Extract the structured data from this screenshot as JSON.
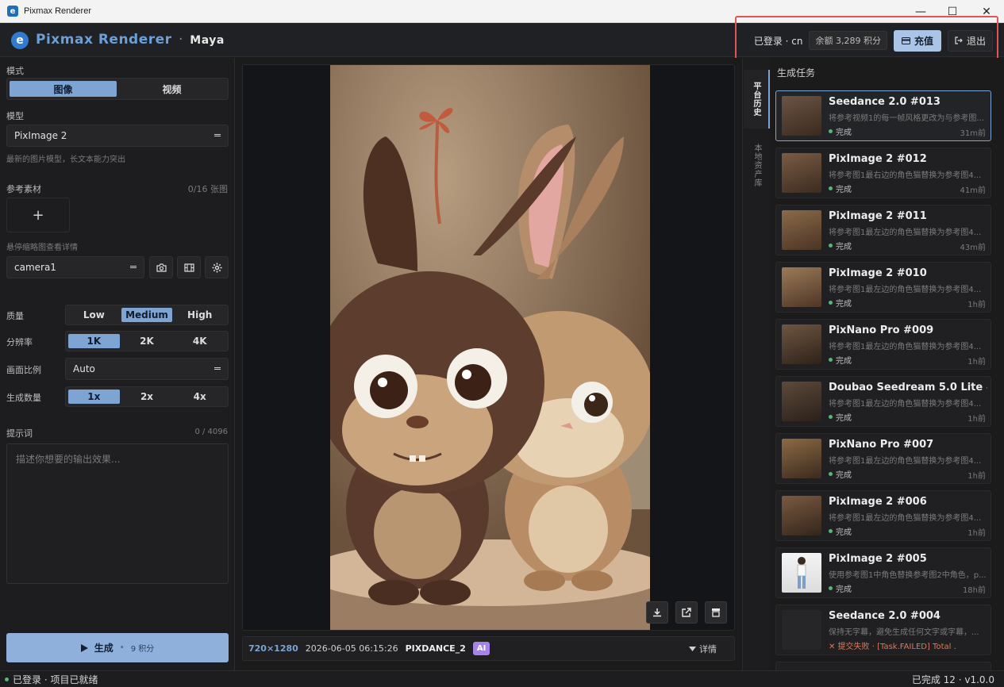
{
  "window": {
    "title": "Pixmax Renderer",
    "minimize": "—",
    "maximize": "☐",
    "close": "✕"
  },
  "header": {
    "logo_letter": "e",
    "brand": "Pixmax Renderer",
    "separator": "·",
    "user": "Maya",
    "login_status": "已登录 · cn",
    "balance": "余额 3,289 积分",
    "recharge": "充值",
    "logout": "退出"
  },
  "left": {
    "mode_label": "模式",
    "mode_options": [
      "图像",
      "视频"
    ],
    "model_label": "模型",
    "model_value": "PixImage 2",
    "model_hint": "最新的图片模型，长文本能力突出",
    "ref_label": "参考素材",
    "ref_count": "0/16 张图",
    "add_symbol": "+",
    "hover_hint": "悬停缩略图查看详情",
    "camera_value": "camera1",
    "quality_label": "质量",
    "quality_options": [
      "Low",
      "Medium",
      "High"
    ],
    "resolution_label": "分辨率",
    "resolution_options": [
      "1K",
      "2K",
      "4K"
    ],
    "aspect_label": "画面比例",
    "aspect_value": "Auto",
    "count_label": "生成数量",
    "count_options": [
      "1x",
      "2x",
      "4x"
    ],
    "prompt_label": "提示词",
    "prompt_count": "0 / 4096",
    "prompt_placeholder": "描述你想要的输出效果...",
    "generate_label": "生成",
    "generate_sep": "•",
    "generate_cost": "9 积分"
  },
  "viewer": {
    "resolution": "720×1280",
    "timestamp": "2026-06-05 06:15:26",
    "tag": "PIXDANCE_2",
    "ai_badge": "AI",
    "detail": "详情"
  },
  "vtabs": [
    "平台历史",
    "本地资产库"
  ],
  "tasks_header": "生成任务",
  "tasks": [
    {
      "title": "Seedance 2.0 #013",
      "desc": "将参考视频1的每一帧风格更改为与参考图...",
      "status": "完成",
      "time": "31m前"
    },
    {
      "title": "PixImage 2 #012",
      "desc": "将参考图1最右边的角色猫替换为参考图4...",
      "status": "完成",
      "time": "41m前"
    },
    {
      "title": "PixImage 2 #011",
      "desc": "将参考图1最左边的角色猫替换为参考图4...",
      "status": "完成",
      "time": "43m前"
    },
    {
      "title": "PixImage 2 #010",
      "desc": "将参考图1最左边的角色猫替换为参考图4...",
      "status": "完成",
      "time": "1h前"
    },
    {
      "title": "PixNano Pro #009",
      "desc": "将参考图1最左边的角色猫替换为参考图4...",
      "status": "完成",
      "time": "1h前"
    },
    {
      "title": "Doubao Seedream 5.0 Lite #...",
      "desc": "将参考图1最左边的角色猫替换为参考图4...",
      "status": "完成",
      "time": "1h前"
    },
    {
      "title": "PixNano Pro #007",
      "desc": "将参考图1最左边的角色猫替换为参考图4...",
      "status": "完成",
      "time": "1h前"
    },
    {
      "title": "PixImage 2 #006",
      "desc": "将参考图1最左边的角色猫替换为参考图4...",
      "status": "完成",
      "time": "1h前"
    },
    {
      "title": "PixImage 2 #005",
      "desc": "使用参考图1中角色替换参考图2中角色，p...",
      "status": "完成",
      "time": "18h前"
    },
    {
      "title": "Seedance 2.0 #004",
      "desc": "保持无字幕，避免生成任何文字或字幕，...",
      "status": "✕ 提交失败 · [Task.FAILED] Total ...",
      "time": ""
    }
  ],
  "statusbar": {
    "left": "已登录 · 项目已就绪",
    "right": "已完成 12 · v1.0.0"
  }
}
